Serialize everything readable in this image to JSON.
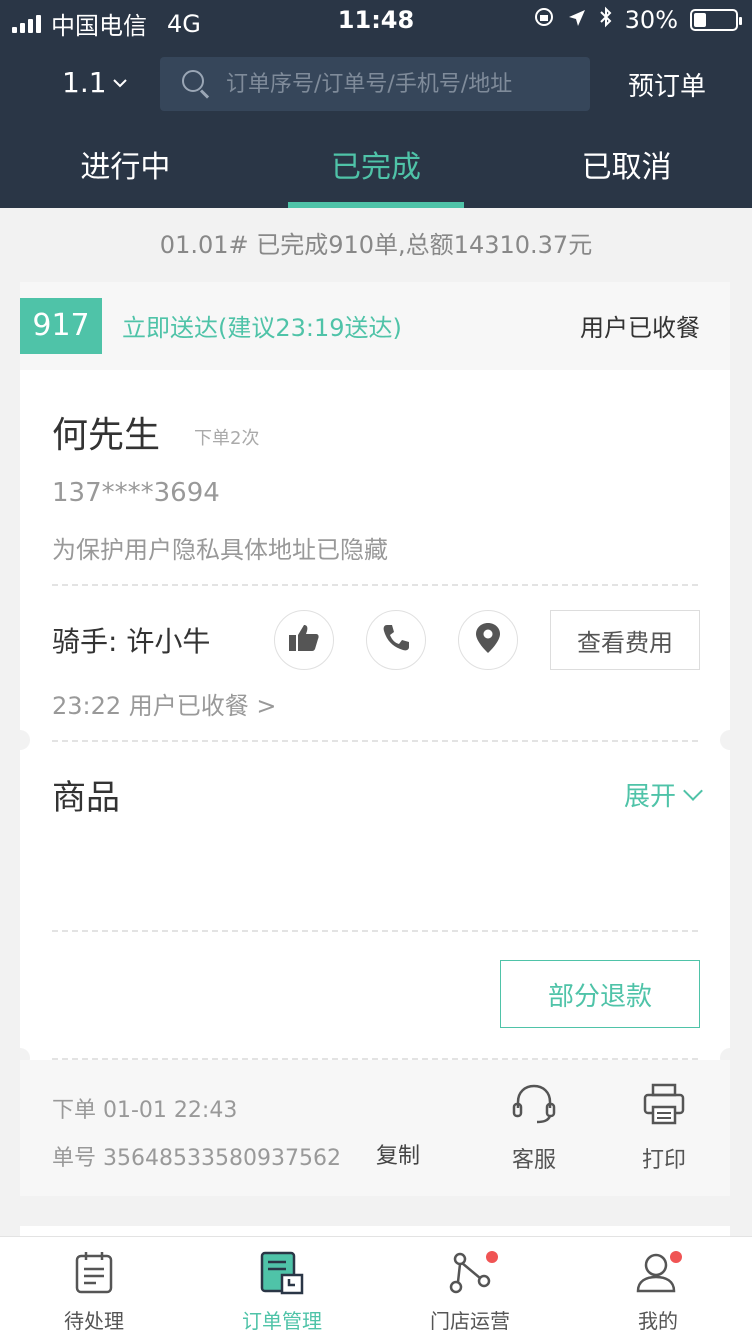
{
  "status_bar": {
    "carrier": "中国电信",
    "network": "4G",
    "time": "11:48",
    "battery_percent": "30%",
    "battery_level": 0.3
  },
  "header": {
    "store_selector": "1.1",
    "search_placeholder": "订单序号/订单号/手机号/地址",
    "preorder_label": "预订单",
    "tabs": [
      {
        "label": "进行中"
      },
      {
        "label": "已完成"
      },
      {
        "label": "已取消"
      }
    ]
  },
  "summary": "01.01# 已完成910单,总额14310.37元",
  "order": {
    "number": "917",
    "delivery_type": "立即送达(建议23:19送达)",
    "status": "用户已收餐",
    "customer_name": "何先生",
    "order_count": "下单2次",
    "phone": "137****3694",
    "address_note": "为保护用户隐私具体地址已隐藏",
    "rider_label": "骑手: 许小牛",
    "fee_button": "查看费用",
    "rider_event": "23:22  用户已收餐 >",
    "goods_title": "商品",
    "expand_label": "展开",
    "refund_button": "部分退款",
    "order_time": "下单 01-01 22:43",
    "order_id": "单号 3564853358093756​2",
    "copy_label": "复制",
    "service_label": "客服",
    "print_label": "打印"
  },
  "bottom_nav": [
    {
      "label": "待处理"
    },
    {
      "label": "订单管理"
    },
    {
      "label": "门店运营"
    },
    {
      "label": "我的"
    }
  ],
  "colors": {
    "header_bg": "#2a3646",
    "accent": "#4fc3a8",
    "badge_dot": "#f05454"
  }
}
